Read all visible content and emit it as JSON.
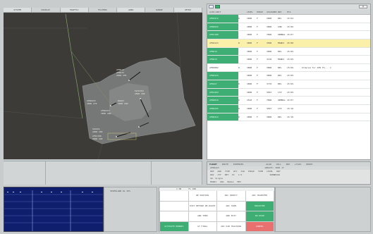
{
  "left_menu": {
    "items": [
      "SYSTEM",
      "DISPLAY",
      "TRAFFIC",
      "FILTERS",
      "AREA",
      "RANGE",
      "SETUP"
    ]
  },
  "radar": {
    "labels": {
      "cluster_top": [
        "AFR614",
        "AFR615",
        "2800 255"
      ],
      "cluster_mid": [
        "KLM1204",
        "2800 260",
        "BAW23",
        "3800 260"
      ],
      "cluster_left": [
        "AFR6025",
        "2800 270",
        "AFR6223",
        "3800 280"
      ],
      "cluster_bottom": [
        "SAS451",
        "2800 285",
        "AFR1188",
        "2800 290"
      ]
    }
  },
  "list": {
    "columns": [
      "ACID/ABCT",
      "LEVEL",
      "PHASE",
      "ASSIGNED",
      "RWY",
      "ETA",
      ""
    ],
    "rows": [
      {
        "cells": [
          "AFR3472",
          "D",
          "3800",
          "F",
          "3800",
          "BPL",
          "15:04",
          ""
        ],
        "style": "green"
      },
      {
        "cells": [
          "AFR6025",
          "",
          "3800",
          "F",
          "3800",
          "LMN",
          "15:06",
          ""
        ],
        "style": "green"
      },
      {
        "cells": [
          "AFR1188",
          "",
          "3800",
          "F",
          "7800",
          "ORMBAL",
          "15:07",
          ""
        ],
        "style": "green"
      },
      {
        "cells": [
          "AFR6223",
          "D",
          "3800",
          "F",
          "3500",
          "MSNKI",
          "15:08",
          ""
        ],
        "style": "highlight"
      },
      {
        "cells": [
          "AFR614",
          "",
          "3800",
          "F",
          "3800",
          "BPL",
          "15:09",
          ""
        ],
        "style": "green"
      },
      {
        "cells": [
          "AFR615",
          "",
          "3800",
          "F",
          "3130",
          "MSNKI",
          "15:09",
          ""
        ],
        "style": "green"
      },
      {
        "cells": [
          "AFR5882",
          "D",
          "3800",
          "F",
          "3800",
          "BPL",
          "15:09",
          "Ordered for AFR FS... J"
        ],
        "style": "white"
      },
      {
        "cells": [
          "AFR6224",
          "",
          "3800",
          "F",
          "3800",
          "BPL",
          "15:09",
          ""
        ],
        "style": "green"
      },
      {
        "cells": [
          "AFR227",
          "D",
          "3800",
          "F",
          "3770",
          "BPL",
          "15:09",
          ""
        ],
        "style": "green"
      },
      {
        "cells": [
          "AFR1204",
          "",
          "3800",
          "F",
          "3507",
          "LTP",
          "15:09",
          ""
        ],
        "style": "green"
      },
      {
        "cells": [
          "AFR6016",
          "D",
          "3510",
          "F",
          "7800",
          "ORMBAL",
          "15:07",
          ""
        ],
        "style": "green"
      },
      {
        "cells": [
          "AFR6225",
          "D",
          "3800",
          "F",
          "3507",
          "LTP",
          "15:10",
          ""
        ],
        "style": "green"
      },
      {
        "cells": [
          "AFR0412",
          "D",
          "3800",
          "F",
          "3800",
          "BPL",
          "15:10",
          ""
        ],
        "style": "green"
      }
    ]
  },
  "detail": {
    "tabs": [
      "FLIGHT",
      "ROUTE",
      "EXPENSES",
      "",
      "ALGN",
      "COLL",
      "RWY",
      "LTAIS",
      "PRINT"
    ],
    "callsign_line": [
      "AFR6223",
      "",
      "",
      "",
      "",
      "",
      "UPDATE: 3805 JT"
    ],
    "sub_line": [
      "DEP",
      "ARR",
      "TYPE",
      "WTC",
      "SSR",
      "PHASE",
      "TIME",
      "LEVEL",
      "RWY"
    ],
    "info_line": [
      "802",
      "3TT",
      "BET",
      "EC",
      "1:5",
      "3DMNBIOR"
    ],
    "line4": [
      "SK. Single"
    ],
    "line5": [
      "MSNKI",
      "ORA",
      "BAULA",
      "MEX"
    ],
    "line6": [
      "15:08:00",
      "15:09:00",
      "17:08:00",
      "17:09:00"
    ]
  },
  "graph_panel": {
    "title": "SEVERLAND  RL  VPS"
  },
  "controls": {
    "top_labels": [
      "1 HR",
      "FL 280"
    ],
    "buttons": [
      {
        "label": "",
        "style": "white"
      },
      {
        "label": "NE ROUTING",
        "style": "white"
      },
      {
        "label": "ARC DIRECT",
        "style": "white"
      },
      {
        "label": "ARC TRANSFER",
        "style": "white"
      },
      {
        "label": "",
        "style": "white"
      },
      {
        "label": "EXIT BEFORE RE-ROUTE",
        "style": "white"
      },
      {
        "label": "ARC TURN",
        "style": "white"
      },
      {
        "label": "ARC READING",
        "style": "white"
      },
      {
        "label": "",
        "style": "white"
      },
      {
        "label": "AND THEN",
        "style": "white"
      },
      {
        "label": "AND EXIT",
        "style": "white"
      },
      {
        "label": "ARC INTERCEPT",
        "style": "white"
      },
      {
        "label": "ACTIVATE RUNWAY",
        "style": "green"
      },
      {
        "label": "AT FINAL",
        "style": "white"
      },
      {
        "label": "ARC DIR TRACKING",
        "style": "white"
      },
      {
        "label": "ARC SPEED",
        "style": "white"
      }
    ],
    "side_buttons": [
      {
        "label": "REGISTER",
        "style": "green"
      },
      {
        "label": "NO RVSM",
        "style": "green"
      },
      {
        "label": "CANCEL",
        "style": "red"
      }
    ]
  }
}
